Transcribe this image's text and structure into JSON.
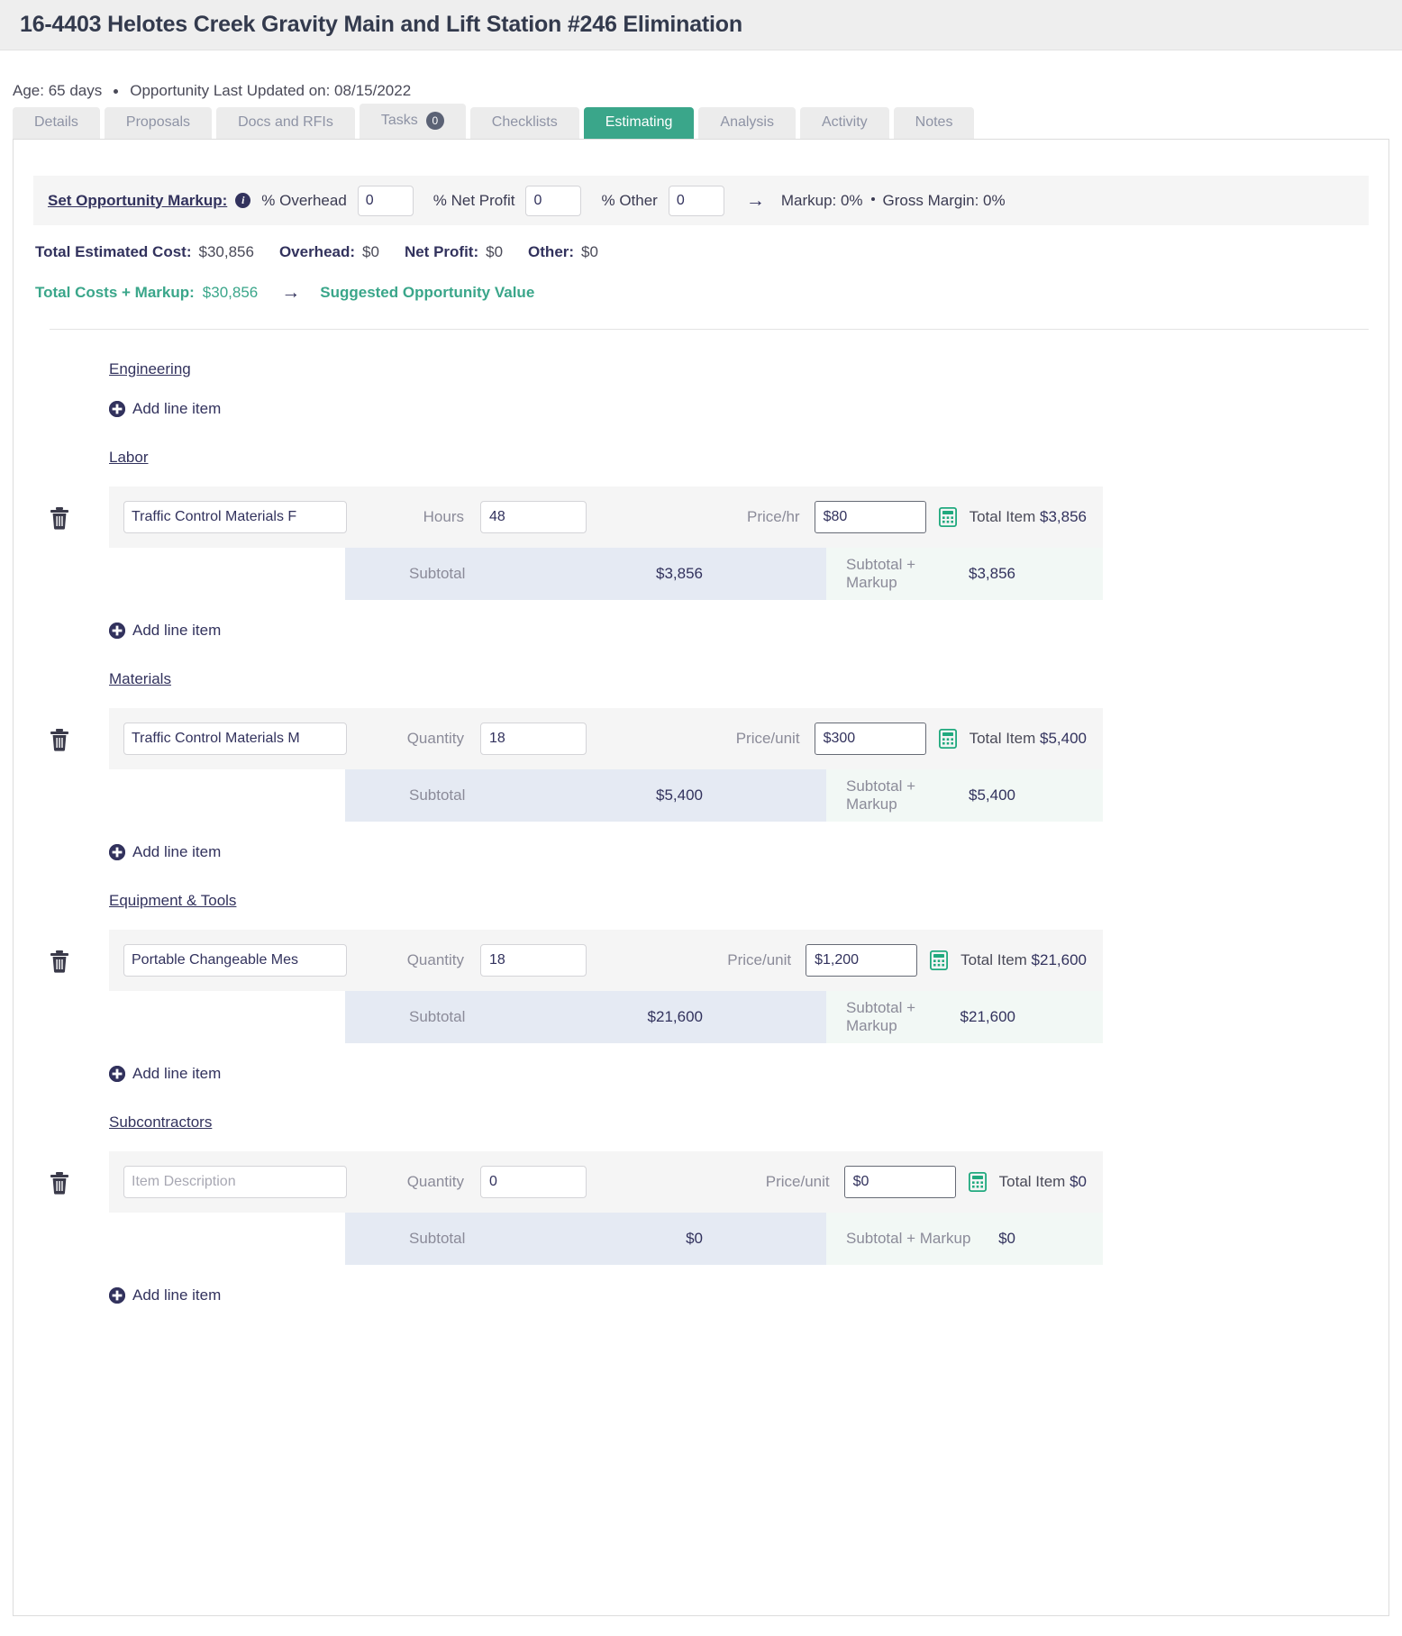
{
  "header": {
    "title": "16-4403 Helotes Creek Gravity Main and Lift Station #246 Elimination",
    "age": "Age: 65 days",
    "last_updated": "Opportunity Last Updated on: 08/15/2022"
  },
  "tabs": [
    {
      "label": "Details",
      "active": false,
      "badge": null
    },
    {
      "label": "Proposals",
      "active": false,
      "badge": null
    },
    {
      "label": "Docs and RFIs",
      "active": false,
      "badge": null
    },
    {
      "label": "Tasks",
      "active": false,
      "badge": "0"
    },
    {
      "label": "Checklists",
      "active": false,
      "badge": null
    },
    {
      "label": "Estimating",
      "active": true,
      "badge": null
    },
    {
      "label": "Analysis",
      "active": false,
      "badge": null
    },
    {
      "label": "Activity",
      "active": false,
      "badge": null
    },
    {
      "label": "Notes",
      "active": false,
      "badge": null
    }
  ],
  "markup_bar": {
    "title": "Set Opportunity Markup:",
    "info_icon": "info-icon",
    "overhead_label": "% Overhead",
    "overhead_value": "0",
    "net_profit_label": "% Net Profit",
    "net_profit_value": "0",
    "other_label": "% Other",
    "other_value": "0",
    "arrow": "→",
    "markup_summary": "Markup: 0%",
    "gross_margin_summary": "Gross Margin: 0%"
  },
  "totals": {
    "total_estimated_cost_label": "Total Estimated Cost:",
    "total_estimated_cost_value": "$30,856",
    "overhead_label": "Overhead:",
    "overhead_value": "$0",
    "net_profit_label": "Net Profit:",
    "net_profit_value": "$0",
    "other_label": "Other:",
    "other_value": "$0",
    "total_costs_markup_label": "Total Costs + Markup:",
    "total_costs_markup_value": "$30,856",
    "arrow": "→",
    "suggested_value_label": "Suggested Opportunity Value"
  },
  "add_line_item_label": "Add line item",
  "labels": {
    "hours": "Hours",
    "quantity": "Quantity",
    "price_hr": "Price/hr",
    "price_unit": "Price/unit",
    "total_item": "Total Item",
    "subtotal": "Subtotal",
    "subtotal_markup": "Subtotal + Markup",
    "item_description_placeholder": "Item Description"
  },
  "colors": {
    "accent_teal": "#3aa68a",
    "header_bg": "#eeeeee",
    "row_bg": "#f5f5f5",
    "subtotal_bg": "#e5eaf3",
    "subtotal_markup_bg": "#f2f8f5",
    "muted_text": "#8b8b99",
    "dark_text": "#32325d"
  },
  "sections": [
    {
      "name": "Engineering",
      "has_items": false,
      "items": []
    },
    {
      "name": "Labor",
      "has_items": true,
      "items": [
        {
          "description": "Traffic Control Materials F",
          "description_placeholder": "Item Description",
          "qty_label": "Hours",
          "qty_value": "48",
          "price_label": "Price/hr",
          "price_value": "$80",
          "total_item_label": "Total Item",
          "total_item_value": "$3,856",
          "subtotal_label": "Subtotal",
          "subtotal_value": "$3,856",
          "subtotal_markup_label": "Subtotal + Markup",
          "subtotal_markup_value": "$3,856"
        }
      ]
    },
    {
      "name": "Materials",
      "has_items": true,
      "items": [
        {
          "description": "Traffic Control Materials M",
          "description_placeholder": "Item Description",
          "qty_label": "Quantity",
          "qty_value": "18",
          "price_label": "Price/unit",
          "price_value": "$300",
          "total_item_label": "Total Item",
          "total_item_value": "$5,400",
          "subtotal_label": "Subtotal",
          "subtotal_value": "$5,400",
          "subtotal_markup_label": "Subtotal + Markup",
          "subtotal_markup_value": "$5,400"
        }
      ]
    },
    {
      "name": "Equipment & Tools",
      "has_items": true,
      "items": [
        {
          "description": "Portable Changeable Mes",
          "description_placeholder": "Item Description",
          "qty_label": "Quantity",
          "qty_value": "18",
          "price_label": "Price/unit",
          "price_value": "$1,200",
          "total_item_label": "Total Item",
          "total_item_value": "$21,600",
          "subtotal_label": "Subtotal",
          "subtotal_value": "$21,600",
          "subtotal_markup_label": "Subtotal + Markup",
          "subtotal_markup_value": "$21,600"
        }
      ]
    },
    {
      "name": "Subcontractors",
      "has_items": true,
      "items": [
        {
          "description": "",
          "description_placeholder": "Item Description",
          "qty_label": "Quantity",
          "qty_value": "0",
          "price_label": "Price/unit",
          "price_value": "$0",
          "total_item_label": "Total Item",
          "total_item_value": "$0",
          "subtotal_label": "Subtotal",
          "subtotal_value": "$0",
          "subtotal_markup_label": "Subtotal + Markup",
          "subtotal_markup_value": "$0"
        }
      ]
    }
  ]
}
